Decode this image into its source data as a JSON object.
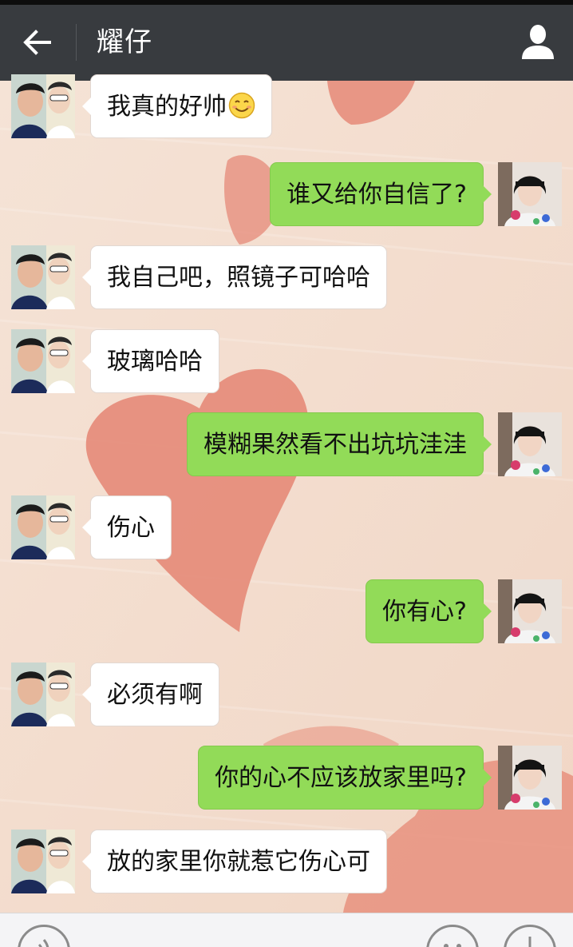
{
  "header": {
    "title": "耀仔",
    "back_icon": "arrow-left-icon",
    "profile_icon": "person-icon"
  },
  "colors": {
    "header_bg": "#383b3f",
    "chat_bg": "#f3dccd",
    "heart": "#e58a78",
    "sent_bubble": "#92db58",
    "received_bubble": "#ffffff"
  },
  "messages": [
    {
      "side": "left",
      "text": "我真的好帅",
      "emoji": "smiling-face-icon"
    },
    {
      "side": "right",
      "text": "谁又给你自信了?"
    },
    {
      "side": "left",
      "text": "我自己吧，照镜子可哈哈"
    },
    {
      "side": "left",
      "text": "玻璃哈哈"
    },
    {
      "side": "right",
      "text": "模糊果然看不出坑坑洼洼"
    },
    {
      "side": "left",
      "text": "伤心"
    },
    {
      "side": "right",
      "text": "你有心?"
    },
    {
      "side": "left",
      "text": "必须有啊"
    },
    {
      "side": "right",
      "text": "你的心不应该放家里吗?"
    },
    {
      "side": "left",
      "text": "放的家里你就惹它伤心可"
    }
  ],
  "bottom_bar": {
    "voice_icon": "voice-icon",
    "emoji_icon": "emoji-icon",
    "plus_icon": "plus-icon"
  }
}
